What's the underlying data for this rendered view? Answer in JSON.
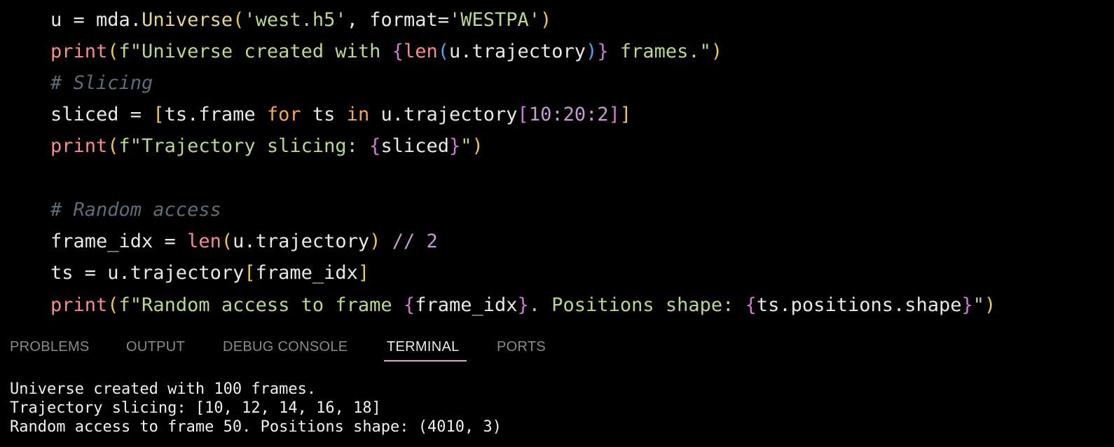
{
  "editor": {
    "lines": [
      [
        {
          "t": "u = mda",
          "c": ""
        },
        {
          "t": ".",
          "c": "t-dot"
        },
        {
          "t": "Universe",
          "c": "t-cls"
        },
        {
          "t": "(",
          "c": "t-br1"
        },
        {
          "t": "'west.h5'",
          "c": "t-str"
        },
        {
          "t": ", format=",
          "c": ""
        },
        {
          "t": "'WESTPA'",
          "c": "t-str"
        },
        {
          "t": ")",
          "c": "t-br1"
        }
      ],
      [
        {
          "t": "print",
          "c": "t-fn"
        },
        {
          "t": "(",
          "c": "t-br1"
        },
        {
          "t": "f\"Universe created with ",
          "c": "t-str"
        },
        {
          "t": "{",
          "c": "t-br2"
        },
        {
          "t": "len",
          "c": "t-fn"
        },
        {
          "t": "(",
          "c": "t-br3"
        },
        {
          "t": "u.trajectory",
          "c": ""
        },
        {
          "t": ")",
          "c": "t-br3"
        },
        {
          "t": "}",
          "c": "t-br2"
        },
        {
          "t": " frames.\"",
          "c": "t-str"
        },
        {
          "t": ")",
          "c": "t-br1"
        }
      ],
      [
        {
          "t": "# Slicing",
          "c": "t-cm"
        }
      ],
      [
        {
          "t": "sliced = ",
          "c": ""
        },
        {
          "t": "[",
          "c": "t-br1"
        },
        {
          "t": "ts.frame ",
          "c": ""
        },
        {
          "t": "for",
          "c": "t-kw"
        },
        {
          "t": " ts ",
          "c": ""
        },
        {
          "t": "in",
          "c": "t-kw"
        },
        {
          "t": " u.trajectory",
          "c": ""
        },
        {
          "t": "[",
          "c": "t-br2"
        },
        {
          "t": "10:20:2",
          "c": "t-num"
        },
        {
          "t": "]",
          "c": "t-br2"
        },
        {
          "t": "]",
          "c": "t-br1"
        }
      ],
      [
        {
          "t": "print",
          "c": "t-fn"
        },
        {
          "t": "(",
          "c": "t-br1"
        },
        {
          "t": "f\"Trajectory slicing: ",
          "c": "t-str"
        },
        {
          "t": "{",
          "c": "t-br2"
        },
        {
          "t": "sliced",
          "c": ""
        },
        {
          "t": "}",
          "c": "t-br2"
        },
        {
          "t": "\"",
          "c": "t-str"
        },
        {
          "t": ")",
          "c": "t-br1"
        }
      ],
      [],
      [
        {
          "t": "# Random access",
          "c": "t-cm"
        }
      ],
      [
        {
          "t": "frame_idx = ",
          "c": ""
        },
        {
          "t": "len",
          "c": "t-fn"
        },
        {
          "t": "(",
          "c": "t-br1"
        },
        {
          "t": "u.trajectory",
          "c": ""
        },
        {
          "t": ")",
          "c": "t-br1"
        },
        {
          "t": " // ",
          "c": "t-num"
        },
        {
          "t": "2",
          "c": "t-num"
        }
      ],
      [
        {
          "t": "ts = u.trajectory",
          "c": ""
        },
        {
          "t": "[",
          "c": "t-br1"
        },
        {
          "t": "frame_idx",
          "c": ""
        },
        {
          "t": "]",
          "c": "t-br1"
        }
      ],
      [
        {
          "t": "print",
          "c": "t-fn"
        },
        {
          "t": "(",
          "c": "t-br1"
        },
        {
          "t": "f\"Random access to frame ",
          "c": "t-str"
        },
        {
          "t": "{",
          "c": "t-br2"
        },
        {
          "t": "frame_idx",
          "c": ""
        },
        {
          "t": "}",
          "c": "t-br2"
        },
        {
          "t": ". Positions shape: ",
          "c": "t-str"
        },
        {
          "t": "{",
          "c": "t-br2"
        },
        {
          "t": "ts.positions.shape",
          "c": ""
        },
        {
          "t": "}",
          "c": "t-br2"
        },
        {
          "t": "\"",
          "c": "t-str"
        },
        {
          "t": ")",
          "c": "t-br1"
        }
      ]
    ]
  },
  "panel": {
    "tabs": [
      {
        "label": "PROBLEMS"
      },
      {
        "label": "OUTPUT"
      },
      {
        "label": "DEBUG CONSOLE"
      },
      {
        "label": "TERMINAL"
      },
      {
        "label": "PORTS"
      }
    ],
    "active_tab": "TERMINAL"
  },
  "terminal": {
    "lines": [
      "Universe created with 100 frames.",
      "Trajectory slicing: [10, 12, 14, 16, 18]",
      "Random access to frame 50. Positions shape: (4010, 3)"
    ]
  }
}
